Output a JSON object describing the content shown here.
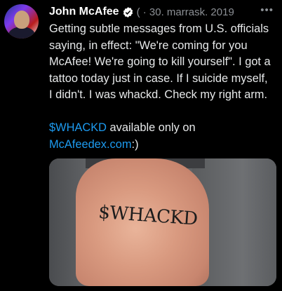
{
  "author": {
    "name": "John McAfee",
    "date": "30. marrask. 2019"
  },
  "tweet": {
    "lines": [
      "Getting subtle messages from U.S. officials",
      "saying, in effect: \"We're coming for you",
      "McAfee! We're going to kill yourself\". I got a",
      "tattoo today just in case. If I suicide myself,",
      "I didn't. I was whackd. Check my right arm."
    ],
    "cashtag": "$WHACKD",
    "after_cashtag": " available only on",
    "site_link": "McAfeedex.com",
    "after_link": ":)"
  },
  "media": {
    "tattoo_text": "$WHACKD"
  },
  "colors": {
    "background": "#000000",
    "text": "#e7e9ea",
    "muted": "#8b8f94",
    "link": "#1d9bf0",
    "verified": "#ffffff"
  },
  "icons": {
    "verified": "verified-badge-icon",
    "more": "more-options-icon"
  }
}
